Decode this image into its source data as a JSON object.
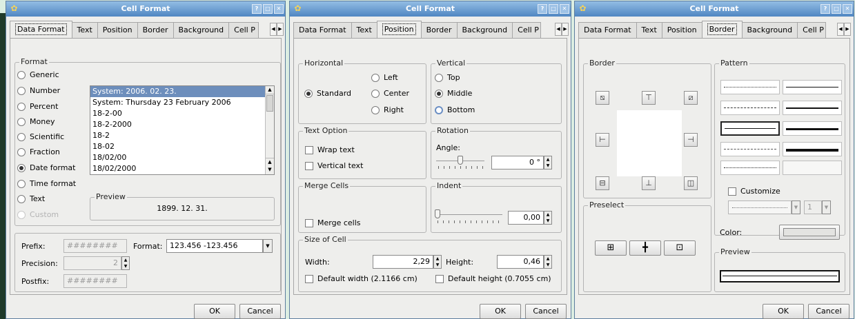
{
  "title": "Cell Format",
  "tabs": [
    "Data Format",
    "Text",
    "Position",
    "Border",
    "Background",
    "Cell P"
  ],
  "buttons": {
    "ok": "OK",
    "cancel": "Cancel"
  },
  "d1": {
    "format_label": "Format",
    "radios": [
      "Generic",
      "Number",
      "Percent",
      "Money",
      "Scientific",
      "Fraction",
      "Date format",
      "Time format",
      "Text",
      "Custom"
    ],
    "selected_radio": "Date format",
    "list": [
      "System: 2006. 02. 23.",
      "System: Thursday 23 February 2006",
      "18-2-00",
      "18-2-2000",
      "18-2",
      "18-02",
      "18/02/00",
      "18/02/2000"
    ],
    "preview_label": "Preview",
    "preview_value": "1899. 12. 31.",
    "prefix_label": "Prefix:",
    "prefix_value": "########",
    "format_field_label": "Format:",
    "format_field_value": "123.456    -123.456",
    "precision_label": "Precision:",
    "precision_value": "2",
    "postfix_label": "Postfix:",
    "postfix_value": "########"
  },
  "d2": {
    "horizontal_label": "Horizontal",
    "h_left": "Left",
    "h_standard": "Standard",
    "h_center": "Center",
    "h_right": "Right",
    "vertical_label": "Vertical",
    "v_top": "Top",
    "v_middle": "Middle",
    "v_bottom": "Bottom",
    "text_option_label": "Text Option",
    "wrap_text": "Wrap text",
    "vertical_text": "Vertical text",
    "rotation_label": "Rotation",
    "angle_label": "Angle:",
    "angle_value": "0 °",
    "merge_label": "Merge Cells",
    "merge_cells": "Merge cells",
    "indent_label": "Indent",
    "indent_value": "0,00",
    "size_label": "Size of Cell",
    "width_label": "Width:",
    "width_value": "2,29",
    "height_label": "Height:",
    "height_value": "0,46",
    "default_width": "Default width (2.1166 cm)",
    "default_height": "Default height (0.7055 cm)"
  },
  "d3": {
    "border_label": "Border",
    "pattern_label": "Pattern",
    "customize": "Customize",
    "custom_size": "1",
    "color_label": "Color:",
    "preselect_label": "Preselect",
    "preview_label": "Preview"
  }
}
